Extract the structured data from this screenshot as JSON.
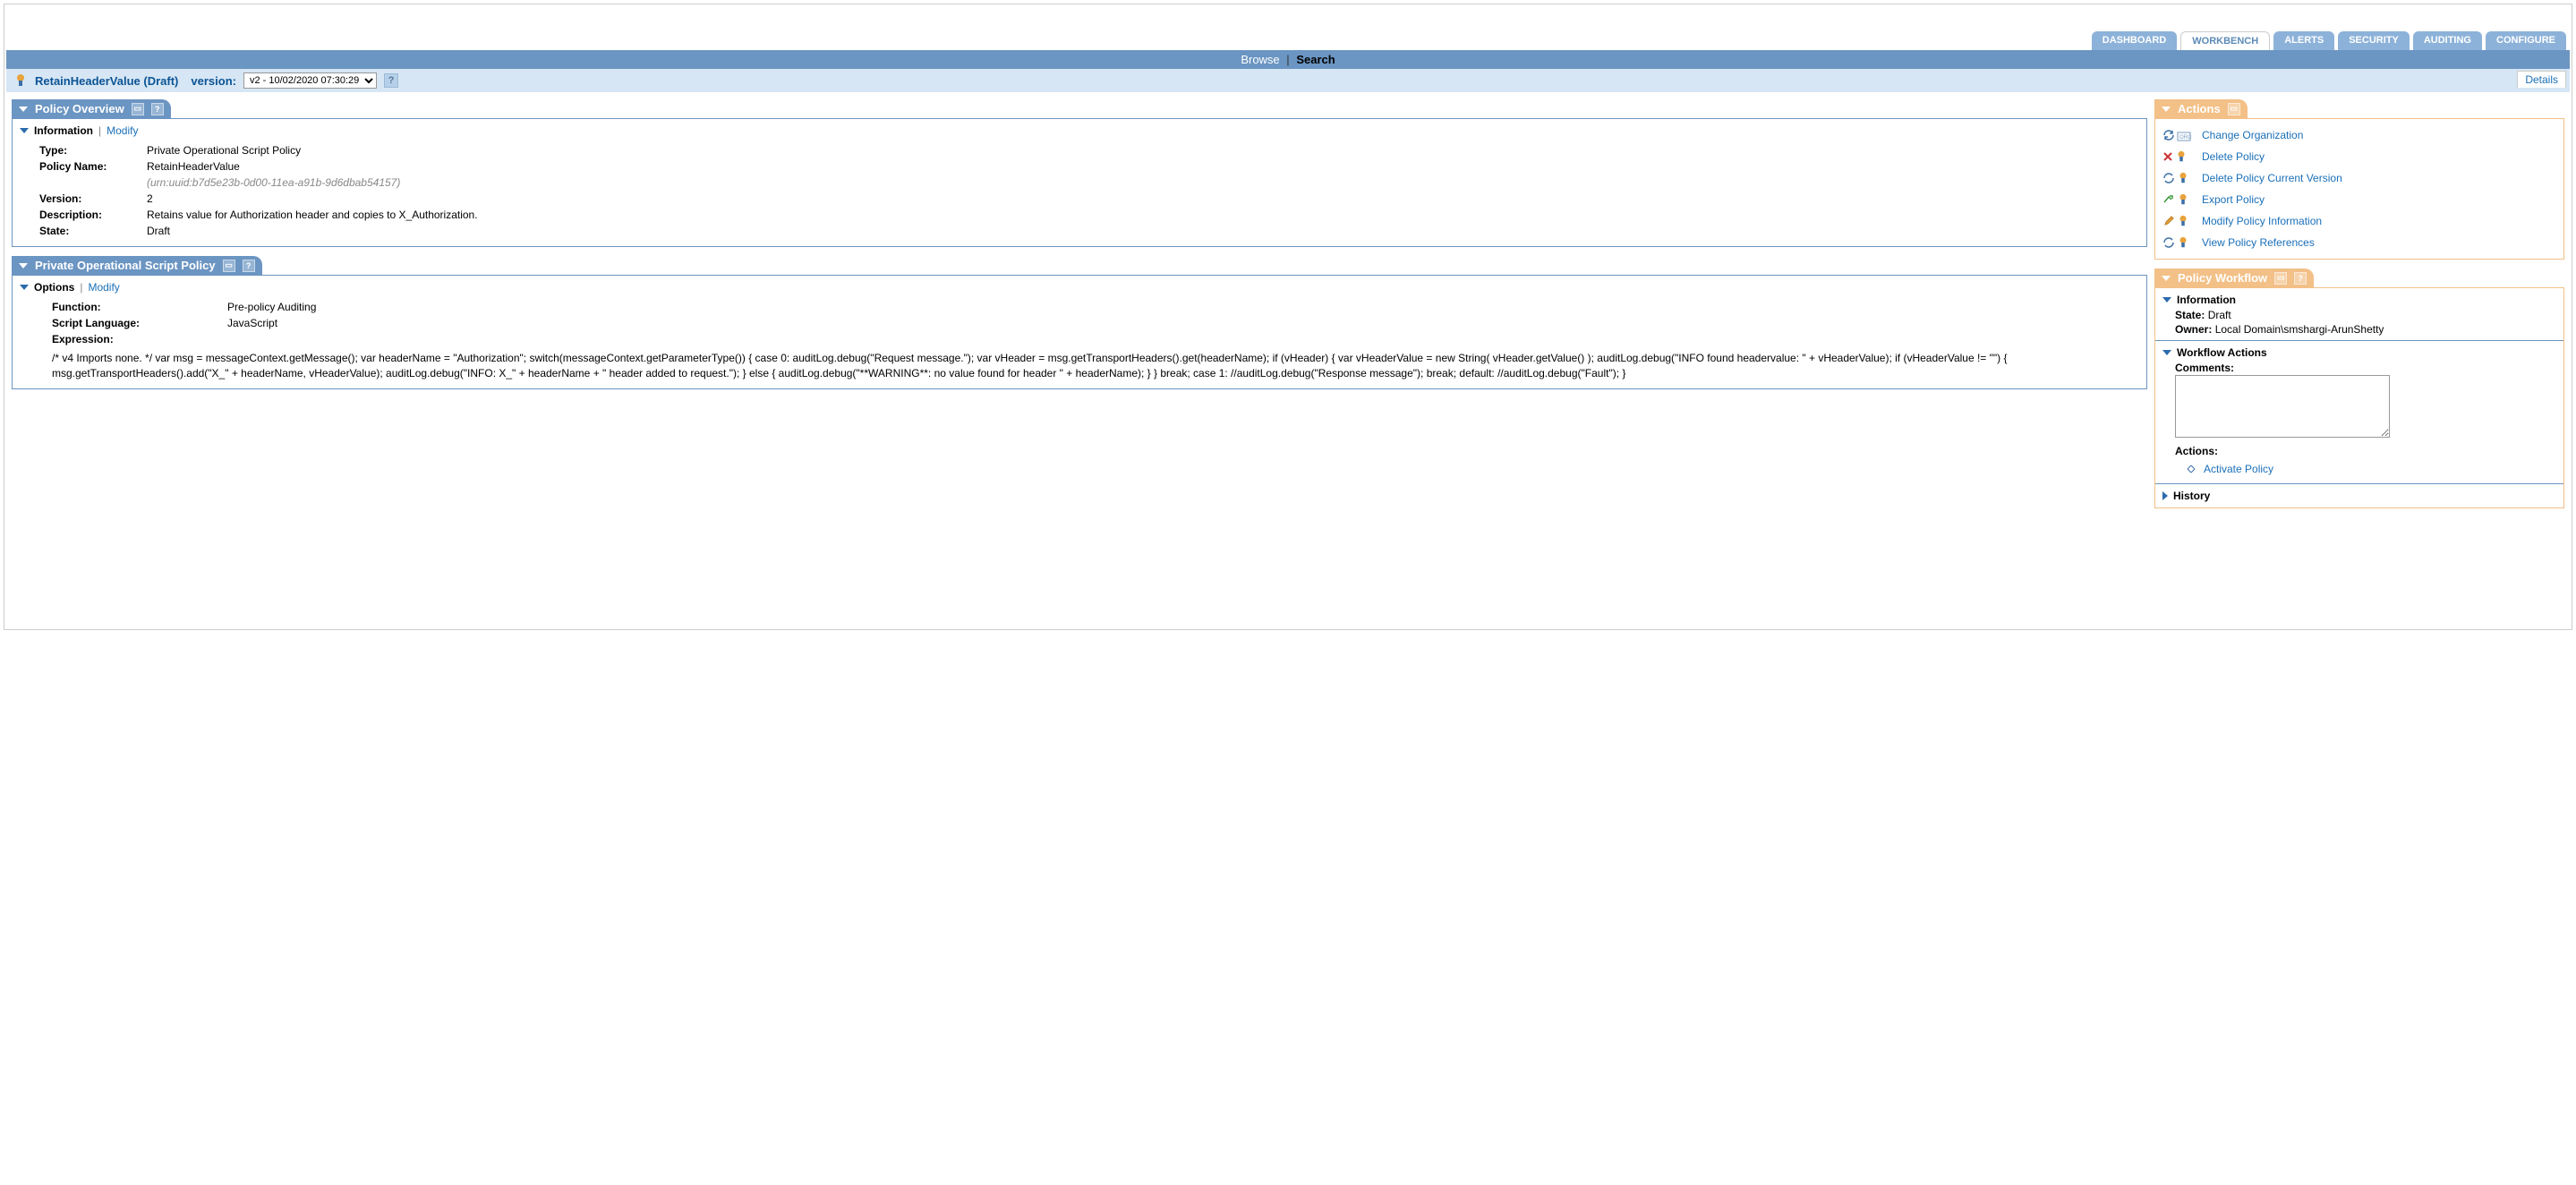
{
  "tabs": {
    "dashboard": "DASHBOARD",
    "workbench": "WORKBENCH",
    "alerts": "ALERTS",
    "security": "SECURITY",
    "auditing": "AUDITING",
    "configure": "CONFIGURE"
  },
  "subnav": {
    "browse": "Browse",
    "search": "Search"
  },
  "title": {
    "name": "RetainHeaderValue (Draft)",
    "version_label": "version:",
    "version_selected": "v2 - 10/02/2020 07:30:29",
    "details": "Details"
  },
  "overview": {
    "header": "Policy Overview",
    "section": "Information",
    "modify": "Modify",
    "rows": {
      "type_label": "Type:",
      "type_value": "Private Operational Script Policy",
      "name_label": "Policy Name:",
      "name_value": "RetainHeaderValue",
      "uuid": "(urn:uuid:b7d5e23b-0d00-11ea-a91b-9d6dbab54157)",
      "version_label": "Version:",
      "version_value": "2",
      "desc_label": "Description:",
      "desc_value": "Retains value for Authorization header and copies to X_Authorization.",
      "state_label": "State:",
      "state_value": "Draft"
    }
  },
  "script": {
    "header": "Private Operational Script Policy",
    "section": "Options",
    "modify": "Modify",
    "rows": {
      "function_label": "Function:",
      "function_value": "Pre-policy Auditing",
      "lang_label": "Script Language:",
      "lang_value": "JavaScript",
      "expr_label": "Expression:"
    },
    "expression": "/* v4 Imports none. */ var msg = messageContext.getMessage(); var headerName = \"Authorization\"; switch(messageContext.getParameterType()) { case 0: auditLog.debug(\"Request message.\"); var vHeader = msg.getTransportHeaders().get(headerName); if (vHeader) { var vHeaderValue = new String( vHeader.getValue() ); auditLog.debug(\"INFO found headervalue: \" + vHeaderValue); if (vHeaderValue != \"\") { msg.getTransportHeaders().add(\"X_\" + headerName, vHeaderValue); auditLog.debug(\"INFO: X_\" + headerName + \" header added to request.\"); } else { auditLog.debug(\"**WARNING**: no value found for header \" + headerName); } } break; case 1: //auditLog.debug(\"Response message\"); break; default: //auditLog.debug(\"Fault\"); }"
  },
  "actions": {
    "header": "Actions",
    "items": {
      "change_org": "Change Organization",
      "delete_policy": "Delete Policy",
      "delete_version": "Delete Policy Current Version",
      "export_policy": "Export Policy",
      "modify_info": "Modify Policy Information",
      "view_refs": "View Policy References"
    }
  },
  "workflow": {
    "header": "Policy Workflow",
    "info_section": "Information",
    "state_label": "State:",
    "state_value": "Draft",
    "owner_label": "Owner:",
    "owner_value": "Local Domain\\smshargi-ArunShetty",
    "actions_section": "Workflow Actions",
    "comments_label": "Comments:",
    "actions_label": "Actions:",
    "activate": "Activate Policy",
    "history_section": "History"
  }
}
